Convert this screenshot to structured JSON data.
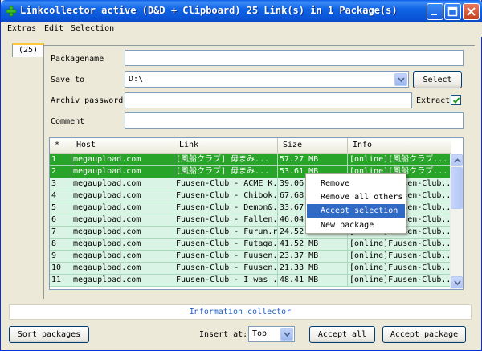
{
  "window": {
    "title": "Linkcollector active (D&D + Clipboard) 25 Link(s) in 1 Package(s)"
  },
  "menu": [
    "Extras",
    "Edit",
    "Selection"
  ],
  "tab_label": "(25)",
  "form": {
    "packagename_label": "Packagename",
    "packagename_value": "",
    "save_to_label": "Save to",
    "save_to_value": "D:\\",
    "select_button": "Select",
    "archiv_password_label": "Archiv password",
    "archiv_password_value": "",
    "extract_label": "Extract",
    "extract_checked": true,
    "comment_label": "Comment",
    "comment_value": ""
  },
  "table": {
    "headers": [
      "*",
      "Host",
      "Link",
      "Size",
      "Info"
    ],
    "rows": [
      {
        "n": "1",
        "host": "megaupload.com",
        "link": "[風船クラブ] 毋まみ...",
        "size": "57.27 MB",
        "info": "[online][風船クラブ...",
        "selected": true
      },
      {
        "n": "2",
        "host": "megaupload.com",
        "link": "[風船クラブ] 毋まみ...",
        "size": "53.61 MB",
        "info": "[online][風船クラブ...",
        "selected": true
      },
      {
        "n": "3",
        "host": "megaupload.com",
        "link": "Fuusen-Club - ACME K...",
        "size": "39.06 MB",
        "info": "[online]Fuusen-Club...",
        "selected": false
      },
      {
        "n": "4",
        "host": "megaupload.com",
        "link": "Fuusen-Club - Chibok...",
        "size": "67.68 MB",
        "info": "[online]Fuusen-Club...",
        "selected": false
      },
      {
        "n": "5",
        "host": "megaupload.com",
        "link": "Fuusen-Club - Demon&...",
        "size": "33.67 MB",
        "info": "[online]Fuusen-Club...",
        "selected": false
      },
      {
        "n": "6",
        "host": "megaupload.com",
        "link": "Fuusen-Club - Fallen...",
        "size": "46.04 MB",
        "info": "[online]Fuusen-Club...",
        "selected": false
      },
      {
        "n": "7",
        "host": "megaupload.com",
        "link": "Fuusen-Club - Furun.rar",
        "size": "24.52 MB",
        "info": "[online]Fuusen-Club...",
        "selected": false
      },
      {
        "n": "8",
        "host": "megaupload.com",
        "link": "Fuusen-Club - Futaga...",
        "size": "41.52 MB",
        "info": "[online]Fuusen-Club...",
        "selected": false
      },
      {
        "n": "9",
        "host": "megaupload.com",
        "link": "Fuusen-Club - Fuusen...",
        "size": "23.37 MB",
        "info": "[online]Fuusen-Club...",
        "selected": false
      },
      {
        "n": "10",
        "host": "megaupload.com",
        "link": "Fuusen-Club - Fuusen...",
        "size": "21.33 MB",
        "info": "[online]Fuusen-Club...",
        "selected": false
      },
      {
        "n": "11",
        "host": "megaupload.com",
        "link": "Fuusen-Club - I was ...",
        "size": "48.41 MB",
        "info": "[online]Fuusen-Club...",
        "selected": false
      }
    ]
  },
  "context_menu": {
    "items": [
      "Remove",
      "Remove all others",
      "Accept selection",
      "New package"
    ],
    "highlighted": 2
  },
  "info_bar": "Information collector",
  "bottom": {
    "sort_packages": "Sort packages",
    "insert_at_label": "Insert at:",
    "insert_at_value": "Top",
    "accept_all": "Accept all",
    "accept_package": "Accept package"
  },
  "colors": {
    "titlebar": "#0a53d6",
    "selected_row": "#28a428",
    "row_bg": "#d9f4e4",
    "menu_highlight": "#316ac5",
    "info_text": "#215dc6"
  }
}
